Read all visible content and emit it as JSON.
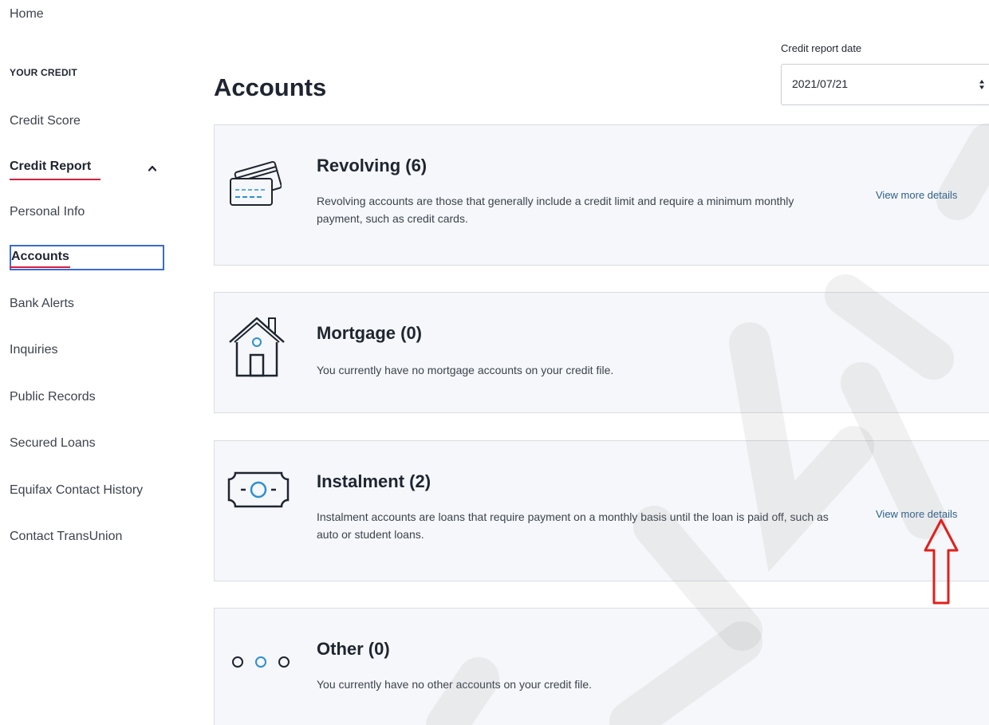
{
  "sidebar": {
    "home": "Home",
    "section_heading": "YOUR CREDIT",
    "items": {
      "credit_score": "Credit Score",
      "credit_report": "Credit Report",
      "personal_info": "Personal Info",
      "accounts": "Accounts",
      "bank_alerts": "Bank Alerts",
      "inquiries": "Inquiries",
      "public_records": "Public Records",
      "secured_loans": "Secured Loans",
      "equifax_contact_history": "Equifax Contact History",
      "contact_transunion": "Contact TransUnion"
    },
    "active_item": "Accounts",
    "expanded_group": "Credit Report"
  },
  "header": {
    "title": "Accounts",
    "date_label": "Credit report date",
    "date_value": "2021/07/21"
  },
  "cards": {
    "revolving": {
      "title": "Revolving (6)",
      "description": "Revolving accounts are those that generally include a credit limit and require a minimum monthly payment, such as credit cards.",
      "link": "View more details",
      "icon": "credit-cards-icon"
    },
    "mortgage": {
      "title": "Mortgage (0)",
      "description": "You currently have no mortgage accounts on your credit file.",
      "icon": "house-icon"
    },
    "instalment": {
      "title": "Instalment (2)",
      "description": "Instalment accounts are loans that require payment on a monthly basis until the loan is paid off, such as auto or student loans.",
      "link": "View more details",
      "icon": "banknote-icon"
    },
    "other": {
      "title": "Other (0)",
      "description": "You currently have no other accounts on your credit file.",
      "icon": "three-circles-icon"
    }
  },
  "colors": {
    "accent_red": "#d71e3c",
    "focus_blue": "#3a6bd4",
    "link_blue": "#2c5f8a",
    "icon_blue": "#2f8fd0",
    "card_background": "#f5f7fa",
    "annotation_arrow": "#e0201e"
  }
}
